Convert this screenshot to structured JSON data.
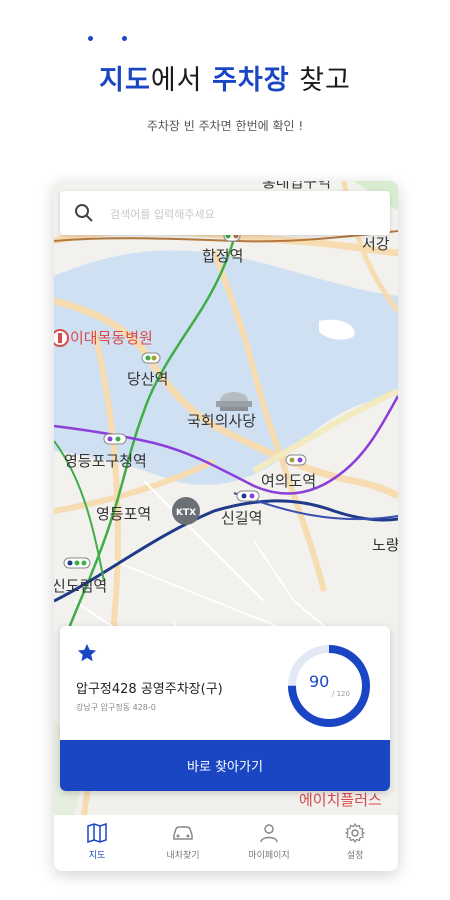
{
  "header": {
    "headline_part1": "지도",
    "headline_part2": "에서 ",
    "headline_part3": "주차장",
    "headline_part4": " 찾고",
    "subtitle": "주차장 빈 주차면 한번에 확인 !"
  },
  "search": {
    "placeholder": "검색어를 입력해주세요"
  },
  "map_labels": {
    "top_station": "홍대입구역",
    "hapjeong": "합정역",
    "seogang": "서강",
    "hospital": "이대목동병원",
    "dangsan": "당산역",
    "assembly": "국회의사당",
    "yeongdeungpo_gu": "영등포구청역",
    "yeouido": "여의도역",
    "yeongdeungpo": "영등포역",
    "ktx": "KTX",
    "singil": "신길역",
    "noryang": "노량",
    "sindorim": "신도림역",
    "h_plus": "에이치플러스"
  },
  "parking_card": {
    "name": "압구정428 공영주차장(구)",
    "address": "강남구 압구정동 428-0",
    "available": 90,
    "total": 120,
    "total_label": "/ 120",
    "cta_label": "바로 찾아가기"
  },
  "tabs": [
    {
      "label": "지도",
      "icon": "map-icon",
      "active": true
    },
    {
      "label": "내차찾기",
      "icon": "car-icon",
      "active": false
    },
    {
      "label": "마이페이지",
      "icon": "person-icon",
      "active": false
    },
    {
      "label": "설정",
      "icon": "gear-icon",
      "active": false
    }
  ],
  "colors": {
    "brand": "#1a46c4",
    "map_water": "#cfe0f2",
    "map_road": "#f6dcb0",
    "subway_green": "#3fae49",
    "subway_purple": "#8b3fd9",
    "subway_navy": "#1f3a8a",
    "subway_brown": "#b5793f"
  }
}
